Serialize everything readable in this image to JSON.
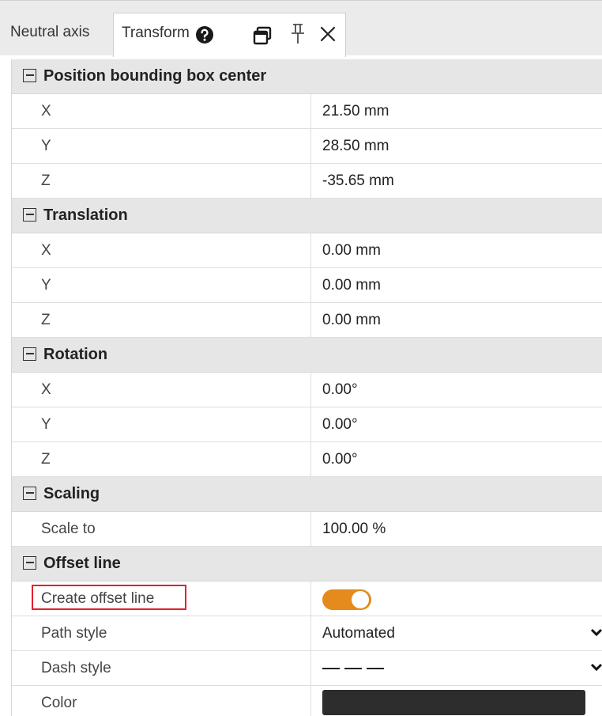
{
  "tabs": {
    "neutral_axis": "Neutral axis",
    "transform": "Transform"
  },
  "icons": {
    "help": "help-circle-icon",
    "window": "window-restore-icon",
    "pin": "pin-icon",
    "close": "close-icon"
  },
  "sections": {
    "position": {
      "title": "Position bounding box center",
      "x_label": "X",
      "x_value": "21.50 mm",
      "y_label": "Y",
      "y_value": "28.50 mm",
      "z_label": "Z",
      "z_value": "-35.65 mm"
    },
    "translation": {
      "title": "Translation",
      "x_label": "X",
      "x_value": "0.00 mm",
      "y_label": "Y",
      "y_value": "0.00 mm",
      "z_label": "Z",
      "z_value": "0.00 mm"
    },
    "rotation": {
      "title": "Rotation",
      "x_label": "X",
      "x_value": "0.00°",
      "y_label": "Y",
      "y_value": "0.00°",
      "z_label": "Z",
      "z_value": "0.00°"
    },
    "scaling": {
      "title": "Scaling",
      "scale_label": "Scale to",
      "scale_value": "100.00 %"
    },
    "offset_line": {
      "title": "Offset line",
      "create_label": "Create offset line",
      "create_enabled": true,
      "path_style_label": "Path style",
      "path_style_value": "Automated",
      "dash_style_label": "Dash style",
      "color_label": "Color",
      "color_value": "#2d2d2d"
    }
  },
  "colors": {
    "accent": "#e58a1c",
    "highlight": "#e2202b"
  }
}
